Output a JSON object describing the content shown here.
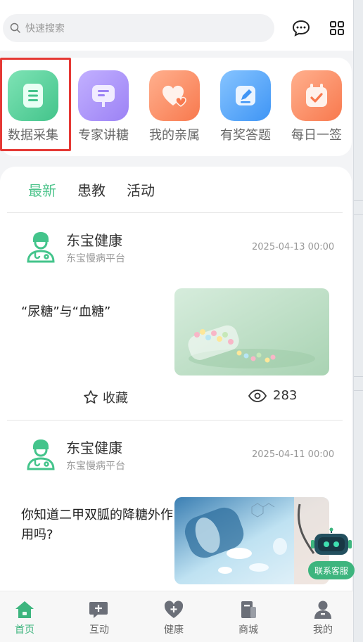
{
  "search": {
    "placeholder": "快速搜索"
  },
  "header_icons": [
    "message-icon",
    "grid-icon"
  ],
  "quick_menu": [
    {
      "label": "数据采集",
      "color": "#5fd3a1",
      "icon": "document-icon"
    },
    {
      "label": "专家讲糖",
      "color": "#a58bf7",
      "icon": "chat-board-icon"
    },
    {
      "label": "我的亲属",
      "color": "#fb8e6a",
      "icon": "hearts-icon"
    },
    {
      "label": "有奖答题",
      "color": "#56a8f9",
      "icon": "edit-icon"
    },
    {
      "label": "每日一签",
      "color": "#fb8e6a",
      "icon": "calendar-check-icon"
    }
  ],
  "feed": {
    "tabs": [
      "最新",
      "患教",
      "活动"
    ],
    "active_tab": "最新",
    "posts": [
      {
        "author": "东宝健康",
        "platform": "东宝慢病平台",
        "date": "2025-04-13 00:00",
        "title": "“尿糖”与“血糖”",
        "fav_label": "收藏",
        "views": "283"
      },
      {
        "author": "东宝健康",
        "platform": "东宝慢病平台",
        "date": "2025-04-11 00:00",
        "title": "你知道二甲双胍的降糖外作用吗?"
      }
    ]
  },
  "service": {
    "label": "联系客服"
  },
  "bottom_nav": [
    {
      "label": "首页",
      "icon": "home-icon",
      "active": true
    },
    {
      "label": "互动",
      "icon": "interaction-icon"
    },
    {
      "label": "健康",
      "icon": "health-heart-icon"
    },
    {
      "label": "商城",
      "icon": "store-icon"
    },
    {
      "label": "我的",
      "icon": "profile-icon"
    }
  ],
  "colors": {
    "accent": "#3db57e",
    "highlight_border": "#e53935"
  }
}
